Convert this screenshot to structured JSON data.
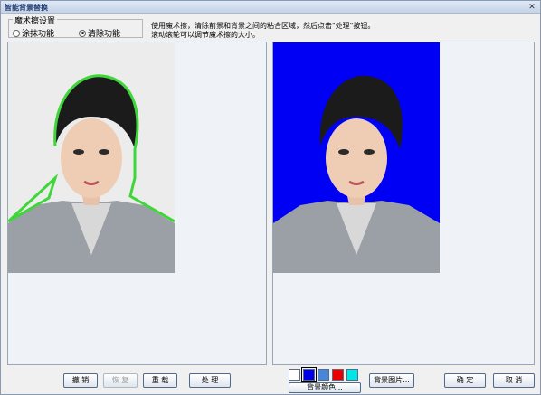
{
  "window": {
    "title": "智能背景替换",
    "close_glyph": "✕"
  },
  "brush_group": {
    "legend": "魔术擦设置",
    "options": [
      {
        "label": "涂抹功能",
        "checked": false
      },
      {
        "label": "清除功能",
        "checked": true
      }
    ]
  },
  "instructions": {
    "line1": "使用魔术擦，清除前景和背景之间的粘合区域，然后点击\"处理\"按钮。",
    "line2": "滚动滚轮可以调节魔术擦的大小。"
  },
  "left_panel": {
    "image": "portrait-with-green-outline",
    "bg_color": "#ececec",
    "outline_color": "#3ed63a"
  },
  "right_panel": {
    "image": "portrait-on-blue",
    "bg_color": "#0000f5"
  },
  "toolbar": {
    "undo_label": "撤 销",
    "redo_label": "恢 复",
    "reload_label": "重 载",
    "process_label": "处 理",
    "bg_color_label": "背景颜色...",
    "bg_image_label": "背景图片...",
    "ok_label": "确 定",
    "cancel_label": "取 消"
  },
  "swatches": [
    {
      "name": "white",
      "color": "#ffffff",
      "selected": false
    },
    {
      "name": "blue",
      "color": "#0000e6",
      "selected": true
    },
    {
      "name": "light-blue",
      "color": "#4a86d6",
      "selected": false
    },
    {
      "name": "red",
      "color": "#e80000",
      "selected": false
    },
    {
      "name": "cyan",
      "color": "#00e6e6",
      "selected": false
    }
  ]
}
